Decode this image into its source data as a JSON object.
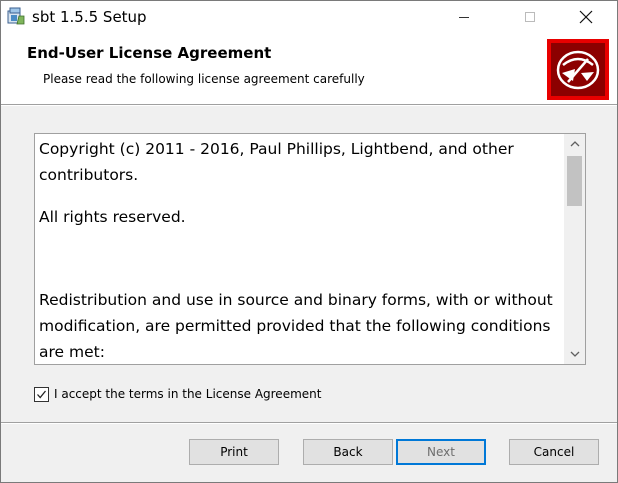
{
  "window": {
    "title": "sbt 1.5.5 Setup"
  },
  "icons": {
    "app": "installer-icon",
    "minimize": "minimize-icon",
    "maximize": "maximize-icon",
    "close": "close-icon",
    "logo": "sbt-logo-icon",
    "scroll_up": "chevron-up-icon",
    "scroll_down": "chevron-down-icon",
    "check": "checkmark-icon"
  },
  "banner": {
    "title": "End-User License Agreement",
    "subtitle": "Please read the following license agreement carefully"
  },
  "license": {
    "paragraphs": [
      "Copyright (c) 2011 - 2016, Paul Phillips, Lightbend, and other contributors.",
      "All rights reserved.",
      "Redistribution and use in source and binary forms, with or without modification, are permitted provided that the following conditions are met:"
    ]
  },
  "accept": {
    "label": "I accept the terms in the License Agreement",
    "checked": true
  },
  "buttons": {
    "print": "Print",
    "back": "Back",
    "next": "Next",
    "cancel": "Cancel"
  },
  "colors": {
    "logo_outer": "#e80000",
    "logo_inner": "#8c0000",
    "focus_border": "#0078d7"
  }
}
